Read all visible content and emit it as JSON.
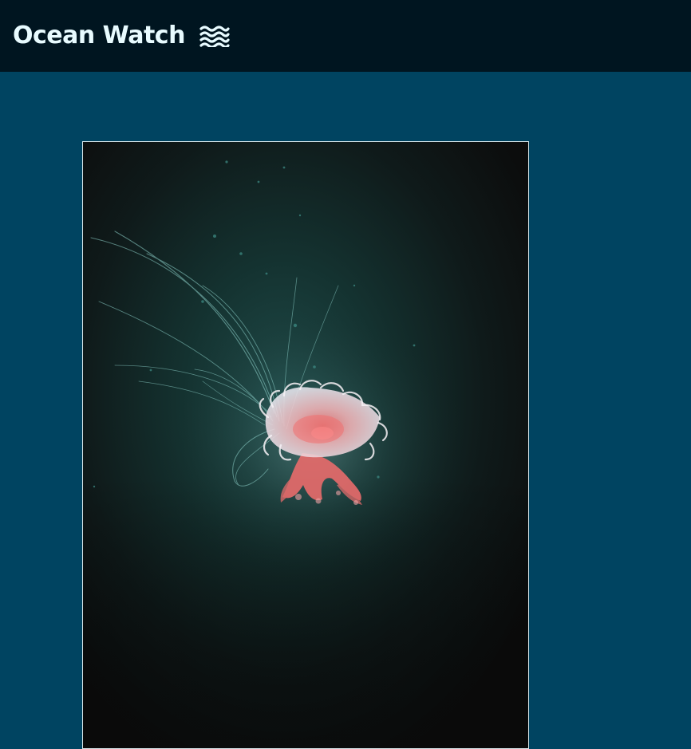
{
  "header": {
    "title": "Ocean Watch",
    "icon": "waves-icon"
  },
  "main": {
    "photo": {
      "subject": "jellyfish",
      "icon": "jellyfish-photo"
    }
  },
  "colors": {
    "header_bg": "#001520",
    "page_bg": "#004461",
    "title_text": "#e8fbff",
    "frame_border": "#d8e6ea"
  }
}
